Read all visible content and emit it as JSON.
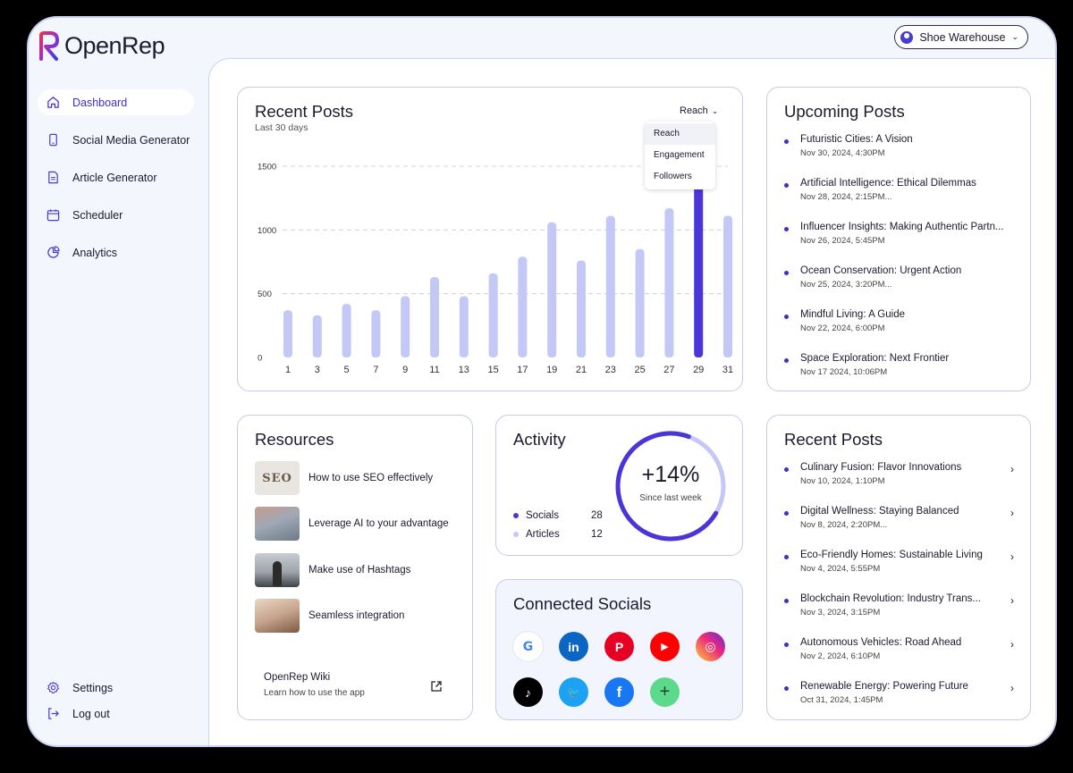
{
  "app": {
    "name": "OpenRep"
  },
  "account": {
    "name": "Shoe Warehouse"
  },
  "sidebar": {
    "items": [
      {
        "label": "Dashboard",
        "icon": "home-icon",
        "active": true
      },
      {
        "label": "Social Media Generator",
        "icon": "phone-icon"
      },
      {
        "label": "Article Generator",
        "icon": "document-icon"
      },
      {
        "label": "Scheduler",
        "icon": "calendar-icon"
      },
      {
        "label": "Analytics",
        "icon": "pie-chart-icon"
      }
    ],
    "settings_label": "Settings",
    "logout_label": "Log out"
  },
  "recent_posts_chart": {
    "title": "Recent Posts",
    "subtitle": "Last 30 days",
    "metric": "Reach",
    "metric_options": [
      "Reach",
      "Engagement",
      "Followers"
    ],
    "highlight_color": "#4a35d8",
    "bar_color": "#c3c8f6"
  },
  "chart_data": {
    "type": "bar",
    "x": [
      1,
      2,
      3,
      4,
      5,
      6,
      7,
      8,
      9,
      10,
      11,
      12,
      13,
      14,
      15,
      16,
      17,
      18,
      19,
      20,
      21,
      22,
      23,
      24,
      25,
      26,
      27,
      28,
      29,
      30,
      31
    ],
    "xticks": [
      1,
      3,
      5,
      7,
      9,
      11,
      13,
      15,
      17,
      19,
      21,
      23,
      25,
      27,
      29,
      31
    ],
    "values": [
      370,
      0,
      330,
      0,
      420,
      0,
      370,
      0,
      480,
      0,
      630,
      0,
      480,
      0,
      660,
      0,
      790,
      0,
      1060,
      0,
      760,
      0,
      1110,
      0,
      850,
      0,
      1170,
      0,
      1750,
      0,
      1110
    ],
    "highlight_x": 29,
    "yticks": [
      0,
      500,
      1000,
      1500
    ],
    "ylim": [
      0,
      1500
    ],
    "grid": true
  },
  "upcoming": {
    "title": "Upcoming Posts",
    "items": [
      {
        "title": "Futuristic Cities: A Vision",
        "date": "Nov 30, 2024, 4:30PM"
      },
      {
        "title": "Artificial Intelligence: Ethical Dilemmas",
        "date": "Nov 28, 2024, 2:15PM..."
      },
      {
        "title": "Influencer Insights: Making Authentic Partn...",
        "date": "Nov 26, 2024, 5:45PM"
      },
      {
        "title": "Ocean Conservation: Urgent Action",
        "date": "Nov 25, 2024, 3:20PM..."
      },
      {
        "title": "Mindful Living: A Guide",
        "date": "Nov 22, 2024, 6:00PM"
      },
      {
        "title": "Space Exploration: Next Frontier",
        "date": "Nov 17 2024, 10:06PM"
      }
    ]
  },
  "resources": {
    "title": "Resources",
    "items": [
      {
        "label": "How to use SEO effectively",
        "thumb_text": "SEO"
      },
      {
        "label": "Leverage AI to your advantage"
      },
      {
        "label": "Make use of Hashtags"
      },
      {
        "label": "Seamless integration"
      }
    ],
    "wiki_title": "OpenRep Wiki",
    "wiki_sub": "Learn how to use the app"
  },
  "activity": {
    "title": "Activity",
    "change": "+14%",
    "change_label": "Since last week",
    "progress": 0.72,
    "rows": [
      {
        "label": "Socials",
        "value": "28",
        "color": "#4a35d8"
      },
      {
        "label": "Articles",
        "value": "12",
        "color": "#c3c8f6"
      }
    ]
  },
  "socials": {
    "title": "Connected Socials",
    "items": [
      {
        "name": "google-icon",
        "glyph": "G",
        "color": "#ffffff"
      },
      {
        "name": "linkedin-icon",
        "glyph": "in",
        "color": "#0a66c2"
      },
      {
        "name": "pinterest-icon",
        "glyph": "P",
        "color": "#e60023"
      },
      {
        "name": "youtube-icon",
        "glyph": "▶",
        "color": "#ff0000"
      },
      {
        "name": "instagram-icon",
        "glyph": "◎",
        "color": "#d62976"
      },
      {
        "name": "tiktok-icon",
        "glyph": "♪",
        "color": "#000000"
      },
      {
        "name": "twitter-icon",
        "glyph": "🐦",
        "color": "#1da1f2"
      },
      {
        "name": "facebook-icon",
        "glyph": "f",
        "color": "#1877f2"
      },
      {
        "name": "add-social-icon",
        "glyph": "+",
        "color": "#5cd98a"
      }
    ]
  },
  "recent": {
    "title": "Recent Posts",
    "items": [
      {
        "title": "Culinary Fusion: Flavor Innovations",
        "date": "Nov 10, 2024, 1:10PM"
      },
      {
        "title": "Digital Wellness: Staying Balanced",
        "date": "Nov 8, 2024, 2:20PM..."
      },
      {
        "title": "Eco-Friendly Homes: Sustainable Living",
        "date": "Nov 4, 2024, 5:55PM"
      },
      {
        "title": "Blockchain Revolution: Industry Trans...",
        "date": "Nov 3, 2024, 3:15PM"
      },
      {
        "title": "Autonomous Vehicles: Road Ahead",
        "date": "Nov 2, 2024, 6:10PM"
      },
      {
        "title": "Renewable Energy: Powering Future",
        "date": "Oct 31, 2024, 1:45PM"
      }
    ]
  }
}
